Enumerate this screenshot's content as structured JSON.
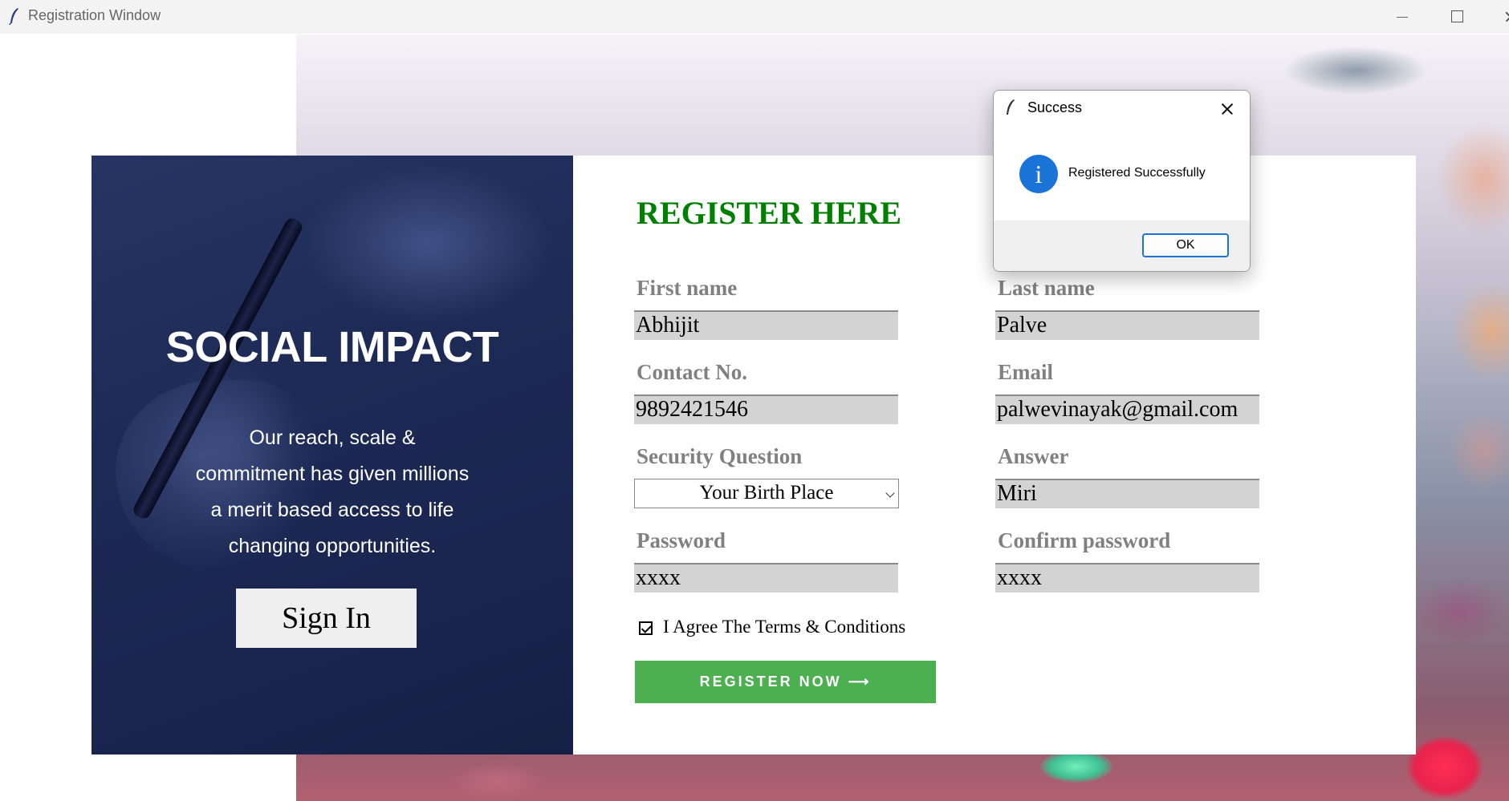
{
  "window": {
    "title": "Registration Window",
    "app_icon": "feather-icon"
  },
  "left_panel": {
    "heading": "SOCIAL IMPACT",
    "text_lines": [
      "Our reach, scale &",
      "commitment has given millions",
      "a merit based access to life",
      "changing opportunities."
    ],
    "sign_in_label": "Sign In"
  },
  "form": {
    "title": "REGISTER HERE",
    "first_name": {
      "label": "First name",
      "value": "Abhijit"
    },
    "last_name": {
      "label": "Last name",
      "value": "Palve"
    },
    "contact": {
      "label": "Contact No.",
      "value": "9892421546"
    },
    "email": {
      "label": "Email",
      "value": "palwevinayak@gmail.com"
    },
    "security_question": {
      "label": "Security Question",
      "selected": "Your Birth Place"
    },
    "answer": {
      "label": "Answer",
      "value": "Miri"
    },
    "password": {
      "label": "Password",
      "value": "xxxx"
    },
    "confirm_password": {
      "label": "Confirm password",
      "value": "xxxx"
    },
    "terms": {
      "label": "I Agree The Terms & Conditions",
      "checked": true
    },
    "register_label": "REGISTER NOW ⟶"
  },
  "dialog": {
    "title": "Success",
    "message": "Registered Successfully",
    "icon": "info-icon",
    "info_glyph": "i",
    "ok_label": "OK"
  },
  "colors": {
    "title_green": "#008000",
    "register_button": "#4caf50",
    "label_gray": "#808080",
    "field_gray": "#d3d3d3",
    "panel_navy": "#1d2a55",
    "info_blue": "#1a73d6"
  }
}
